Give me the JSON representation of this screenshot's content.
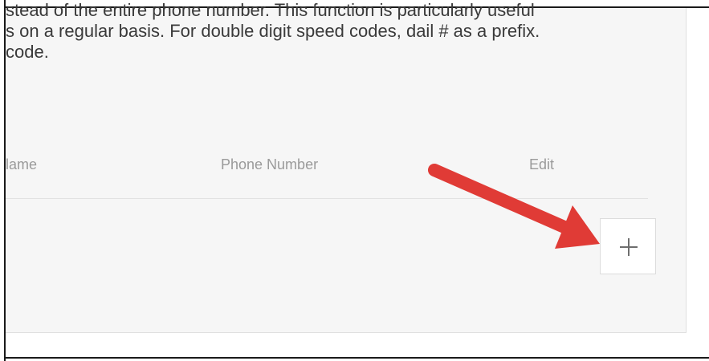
{
  "description": {
    "line1": "stead of the entire phone number. This function is particularly useful",
    "line2": "s on a regular basis. For double digit speed codes, dail # as a prefix.",
    "line3": "code."
  },
  "table": {
    "columns": [
      "Name",
      "Phone Number",
      "Edit"
    ],
    "name_header_visible": "lame"
  },
  "add_button": {
    "icon": "plus-icon"
  },
  "annotation": {
    "icon": "arrow-annotation-icon",
    "color": "#e03b36"
  },
  "colors": {
    "card_background": "#f6f6f6",
    "header_text": "#9a9a9a",
    "body_text": "#3a3a3a"
  }
}
